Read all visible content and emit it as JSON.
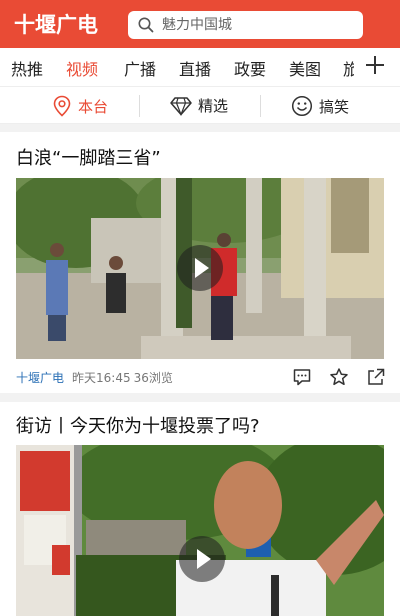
{
  "header": {
    "brand": "十堰广电",
    "search_placeholder": "魅力中国城"
  },
  "tabs": [
    "热推",
    "视频",
    "广播",
    "直播",
    "政要",
    "美图"
  ],
  "tab_overflow": "旅",
  "active_tab": "视频",
  "subtabs": [
    "本台",
    "精选",
    "搞笑"
  ],
  "cards": [
    {
      "title": "白浪“一脚踏三省”",
      "source": "十堰广电",
      "time": "昨天16:45",
      "views": "36浏览"
    },
    {
      "title": "街访丨今天你为十堰投票了吗?"
    }
  ],
  "colors": {
    "accent": "#e94b35",
    "source_link": "#2a6fb5"
  }
}
